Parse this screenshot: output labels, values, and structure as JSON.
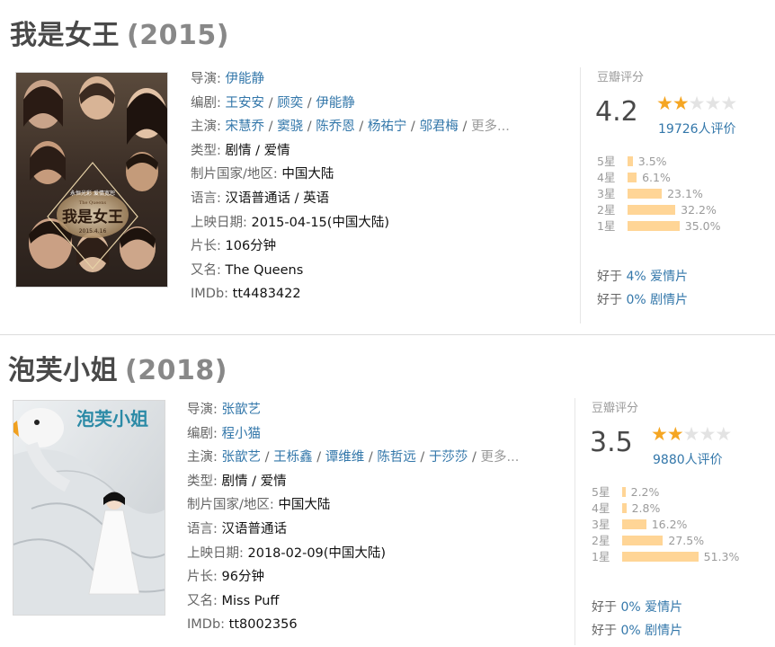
{
  "movies": [
    {
      "title": "我是女王",
      "year": "(2015)",
      "fields": [
        {
          "label": "导演: ",
          "links": [
            "伊能静"
          ],
          "value": ""
        },
        {
          "label": "编剧: ",
          "links": [
            "王安安",
            "顾奕",
            "伊能静"
          ],
          "value": ""
        },
        {
          "label": "主演: ",
          "links": [
            "宋慧乔",
            "窦骁",
            "陈乔恩",
            "杨祐宁",
            "邬君梅"
          ],
          "value": "",
          "more": "更多..."
        },
        {
          "label": "类型: ",
          "links": [],
          "value": "剧情 / 爱情"
        },
        {
          "label": "制片国家/地区: ",
          "links": [],
          "value": "中国大陆"
        },
        {
          "label": "语言: ",
          "links": [],
          "value": "汉语普通话 / 英语"
        },
        {
          "label": "上映日期: ",
          "links": [],
          "value": "2015-04-15(中国大陆)"
        },
        {
          "label": "片长: ",
          "links": [],
          "value": "106分钟"
        },
        {
          "label": "又名: ",
          "links": [],
          "value": "The Queens"
        },
        {
          "label": "IMDb: ",
          "links": [],
          "value": "tt4483422"
        }
      ],
      "rating": {
        "header": "豆瓣评分",
        "score": "4.2",
        "star_count": 2,
        "votes": "19726人评价",
        "distribution": [
          {
            "label": "5星",
            "pct": "3.5%",
            "value": 3.5
          },
          {
            "label": "4星",
            "pct": "6.1%",
            "value": 6.1
          },
          {
            "label": "3星",
            "pct": "23.1%",
            "value": 23.1
          },
          {
            "label": "2星",
            "pct": "32.2%",
            "value": 32.2
          },
          {
            "label": "1星",
            "pct": "35.0%",
            "value": 35.0
          }
        ],
        "better_than": [
          {
            "prefix": "好于 ",
            "value": "4% 爱情片"
          },
          {
            "prefix": "好于 ",
            "value": "0% 剧情片"
          }
        ]
      },
      "poster": {
        "title": "我是女王",
        "eng": "The Queens",
        "date": "2015.4.16",
        "tagline": "永恒光彩 爱情宽恕"
      }
    },
    {
      "title": "泡芙小姐",
      "year": "(2018)",
      "fields": [
        {
          "label": "导演: ",
          "links": [
            "张歆艺"
          ],
          "value": ""
        },
        {
          "label": "编剧: ",
          "links": [
            "程小猫"
          ],
          "value": ""
        },
        {
          "label": "主演: ",
          "links": [
            "张歆艺",
            "王栎鑫",
            "谭维维",
            "陈哲远",
            "于莎莎"
          ],
          "value": "",
          "more": "更多..."
        },
        {
          "label": "类型: ",
          "links": [],
          "value": "剧情 / 爱情"
        },
        {
          "label": "制片国家/地区: ",
          "links": [],
          "value": "中国大陆"
        },
        {
          "label": "语言: ",
          "links": [],
          "value": "汉语普通话"
        },
        {
          "label": "上映日期: ",
          "links": [],
          "value": "2018-02-09(中国大陆)"
        },
        {
          "label": "片长: ",
          "links": [],
          "value": "96分钟"
        },
        {
          "label": "又名: ",
          "links": [],
          "value": "Miss Puff"
        },
        {
          "label": "IMDb: ",
          "links": [],
          "value": "tt8002356"
        }
      ],
      "rating": {
        "header": "豆瓣评分",
        "score": "3.5",
        "star_count": 2,
        "votes": "9880人评价",
        "distribution": [
          {
            "label": "5星",
            "pct": "2.2%",
            "value": 2.2
          },
          {
            "label": "4星",
            "pct": "2.8%",
            "value": 2.8
          },
          {
            "label": "3星",
            "pct": "16.2%",
            "value": 16.2
          },
          {
            "label": "2星",
            "pct": "27.5%",
            "value": 27.5
          },
          {
            "label": "1星",
            "pct": "51.3%",
            "value": 51.3
          }
        ],
        "better_than": [
          {
            "prefix": "好于 ",
            "value": "0% 爱情片"
          },
          {
            "prefix": "好于 ",
            "value": "0% 剧情片"
          }
        ]
      },
      "poster": {
        "title": "泡芙小姐"
      }
    }
  ],
  "colors": {
    "link": "#3377aa",
    "star": "#f5a623",
    "bar": "#ffd596",
    "title": "#494949"
  }
}
